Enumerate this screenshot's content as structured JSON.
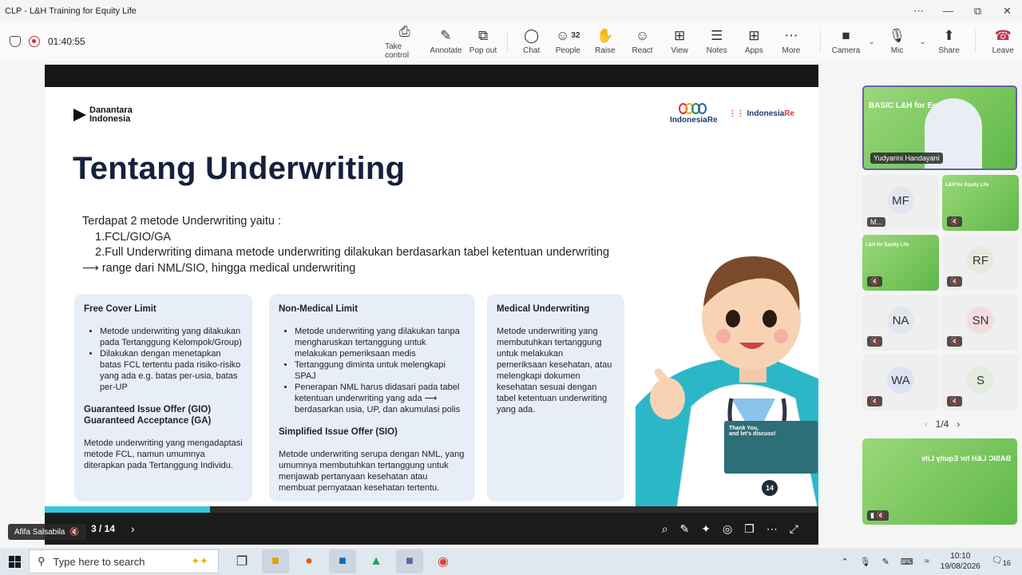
{
  "window": {
    "title": "CLP - L&H Training for Equity Life",
    "controls": [
      "⋯",
      "—",
      "⧉",
      "✕"
    ]
  },
  "meeting": {
    "timer": "01:40:55"
  },
  "toolbar": {
    "items": [
      {
        "label": "Take control",
        "icon": "⎙"
      },
      {
        "label": "Annotate",
        "icon": "✎"
      },
      {
        "label": "Pop out",
        "icon": "⧉"
      },
      {
        "label": "Chat",
        "icon": "◯"
      },
      {
        "label": "People",
        "icon": "☺",
        "count": "32"
      },
      {
        "label": "Raise",
        "icon": "✋"
      },
      {
        "label": "React",
        "icon": "☺"
      },
      {
        "label": "View",
        "icon": "⊞"
      },
      {
        "label": "Notes",
        "icon": "☰"
      },
      {
        "label": "Apps",
        "icon": "⊞"
      },
      {
        "label": "More",
        "icon": "⋯"
      }
    ],
    "camera": "Camera",
    "mic": "Mic",
    "share": "Share",
    "leave": "Leave"
  },
  "slide": {
    "brand_left_1": "Danantara",
    "brand_left_2": "Indonesia",
    "brand_right_1": "IndonesiaRe",
    "brand_right_2_a": "Indonesia",
    "brand_right_2_b": "Re",
    "title": "Tentang Underwriting",
    "intro_1": "Terdapat 2 metode Underwriting yaitu :",
    "intro_2": "1.FCL/GIO/GA",
    "intro_3": "2.Full Underwriting dimana metode underwriting dilakukan berdasarkan tabel ketentuan underwriting",
    "intro_4": "⟶ range dari NML/SIO, hingga medical underwriting",
    "box1": {
      "title": "Free Cover Limit",
      "b1": "Metode underwriting yang dilakukan pada Tertanggung Kelompok/Group)",
      "b2": "Dilakukan dengan menetapkan batas FCL tertentu pada risiko-risiko yang ada e.g.  batas per-usia, batas per-UP",
      "sub1": "Guaranteed Issue Offer (GIO)",
      "sub2": "Guaranteed Acceptance (GA)",
      "p": "Metode underwriting yang mengadaptasi metode FCL, namun umumnya diterapkan pada Tertanggung Individu."
    },
    "box2": {
      "title": "Non-Medical Limit",
      "b1": "Metode underwriting yang dilakukan tanpa mengharuskan tertanggung untuk melakukan pemeriksaan medis",
      "b2": "Tertanggung diminta untuk melengkapi SPAJ",
      "b3": "Penerapan NML harus didasari pada tabel ketentuan underwriting yang ada ⟶ berdasarkan usia, UP, dan akumulasi polis",
      "sub": "Simplified Issue Offer (SIO)",
      "p": "Metode underwriting serupa dengan NML, yang umumnya membutuhkan tertanggung untuk menjawab pertanyaan kesehatan atau membuat pernyataan kesehatan tertentu."
    },
    "box3": {
      "title": "Medical Underwriting",
      "p": "Metode underwriting yang membutuhkan tertanggung untuk melakukan pemeriksaan kesehatan, atau melengkapi dokumen kesehatan sesuai dengan tabel ketentuan underwriting yang ada."
    },
    "preview_text_1": "Thank You,",
    "preview_text_2": "and let's discuss!",
    "page_badge": "14"
  },
  "presentation": {
    "counter": "3 / 14",
    "presenter": "Afifa Salsabila",
    "progress_fraction": 0.214
  },
  "participants": {
    "main": {
      "name": "Yudyarini Handayani",
      "banner": "BASIC L&H for Equ"
    },
    "tiles": [
      {
        "initials": "MF",
        "label": "M..."
      },
      {
        "initials": "",
        "label": "",
        "green": "L&H for Equity Life"
      },
      {
        "initials": "",
        "label": "",
        "green": "L&H for Equity Life"
      },
      {
        "initials": "RF",
        "label": ""
      },
      {
        "initials": "NA",
        "label": ""
      },
      {
        "initials": "SN",
        "label": ""
      },
      {
        "initials": "WA",
        "label": ""
      },
      {
        "initials": "S",
        "label": ""
      }
    ],
    "pager": "1/4",
    "bottom_banner": "BASIC L&H for Equity Life"
  },
  "taskbar": {
    "search_placeholder": "Type here to search",
    "time": "10:10",
    "date": "19/08/2026",
    "notif": "16"
  }
}
